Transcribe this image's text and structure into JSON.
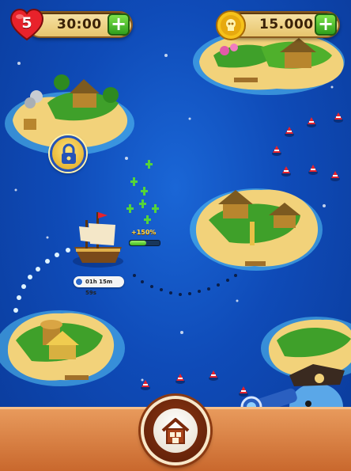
{
  "hud": {
    "lives_count": "5",
    "lives_timer": "30:00",
    "coins": "15.000",
    "add_label": "+"
  },
  "ship": {
    "boost_label": "+150%",
    "boost_level": 0.55,
    "travel_timer": "01h 15m 59s"
  },
  "icons": {
    "heart": "heart-icon",
    "coin": "coin-icon",
    "lock": "lock-icon",
    "home": "home-icon",
    "clock": "clock-icon"
  },
  "colors": {
    "sea": "#0f4bb8",
    "sand": "#f2d27a",
    "accent_green": "#3db51c",
    "bottom_bar": "#d97a3e"
  }
}
